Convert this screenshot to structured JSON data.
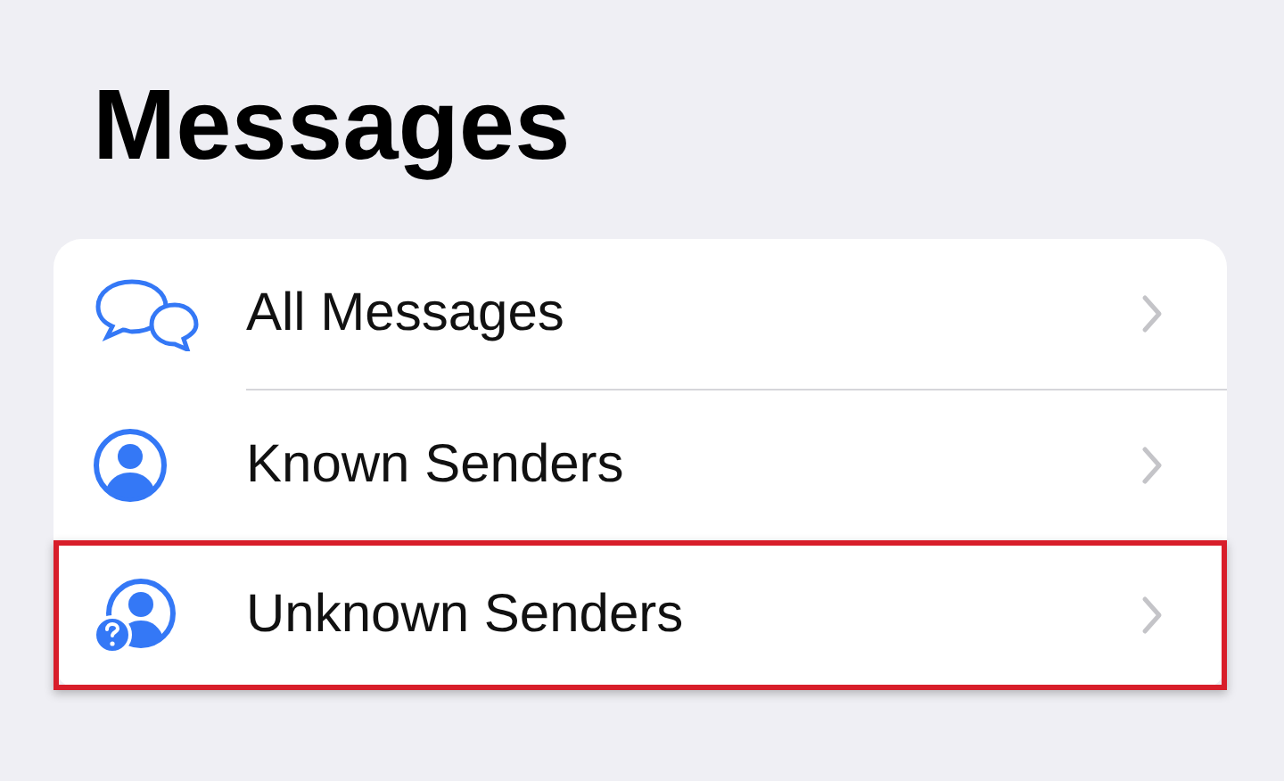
{
  "title": "Messages",
  "items": [
    {
      "label": "All Messages",
      "kind": "chat",
      "highlighted": false
    },
    {
      "label": "Known Senders",
      "kind": "person",
      "highlighted": false
    },
    {
      "label": "Unknown Senders",
      "kind": "unknown",
      "highlighted": true
    }
  ]
}
